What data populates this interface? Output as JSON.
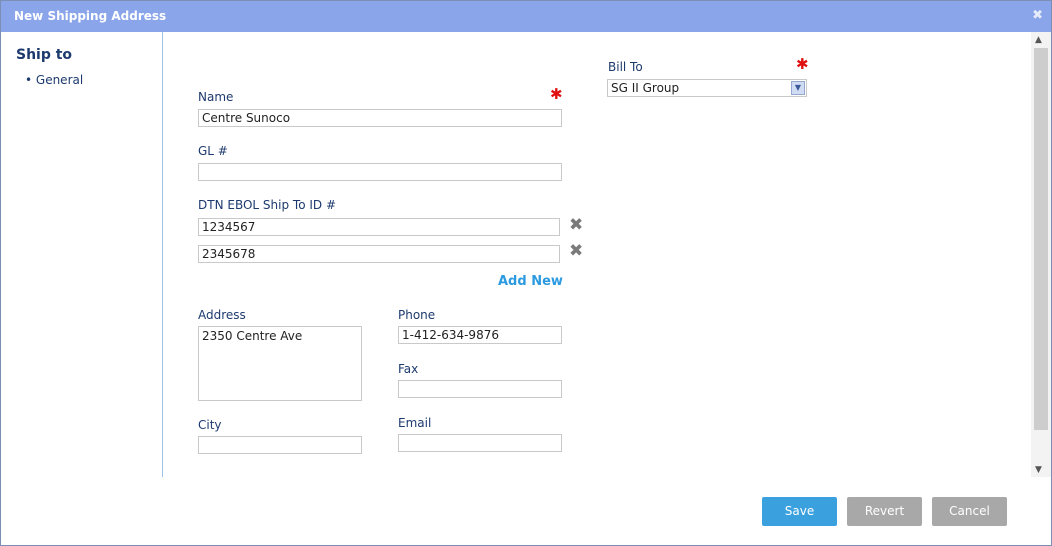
{
  "dialog": {
    "title": "New Shipping Address",
    "close_glyph": "✖"
  },
  "sidebar": {
    "heading": "Ship to",
    "items": [
      {
        "label": "• General"
      }
    ]
  },
  "form": {
    "name": {
      "label": "Name",
      "value": "Centre Sunoco",
      "required_marker": "✱"
    },
    "gl": {
      "label": "GL #",
      "value": ""
    },
    "dtn": {
      "label": "DTN EBOL Ship To ID #",
      "entries": [
        {
          "value": "1234567"
        },
        {
          "value": "2345678"
        }
      ],
      "remove_glyph": "✖",
      "add_new_label": "Add New"
    },
    "address": {
      "label": "Address",
      "value": "2350 Centre Ave"
    },
    "city": {
      "label": "City",
      "value": ""
    },
    "phone": {
      "label": "Phone",
      "value": "1-412-634-9876"
    },
    "fax": {
      "label": "Fax",
      "value": ""
    },
    "email": {
      "label": "Email",
      "value": ""
    },
    "bill_to": {
      "label": "Bill To",
      "value": "SG II Group",
      "required_marker": "✱",
      "dropdown_glyph": "▼"
    }
  },
  "scrollbar": {
    "up_glyph": "▲",
    "down_glyph": "▼"
  },
  "footer": {
    "save_label": "Save",
    "revert_label": "Revert",
    "cancel_label": "Cancel"
  },
  "colors": {
    "titlebar": "#8ba5ea",
    "primary_button": "#3aa1de",
    "secondary_button": "#a8a8a8",
    "required": "#e01010",
    "link": "#2b9ae0"
  }
}
